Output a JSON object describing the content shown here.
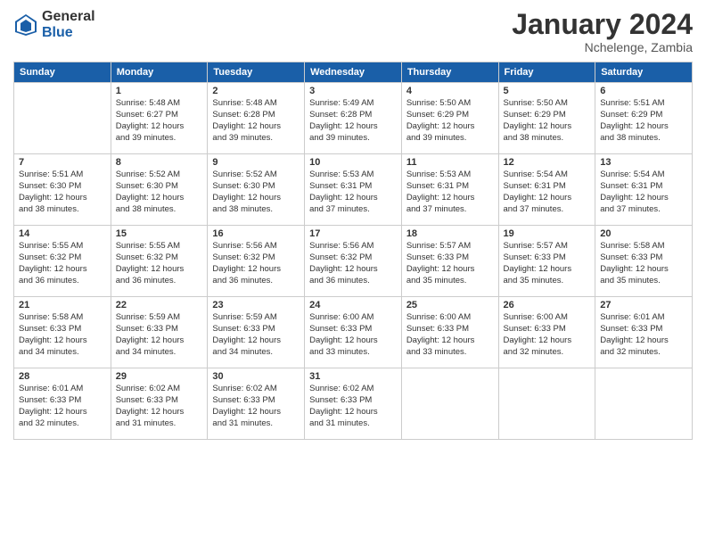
{
  "logo": {
    "general": "General",
    "blue": "Blue"
  },
  "header": {
    "title": "January 2024",
    "subtitle": "Nchelenge, Zambia"
  },
  "weekdays": [
    "Sunday",
    "Monday",
    "Tuesday",
    "Wednesday",
    "Thursday",
    "Friday",
    "Saturday"
  ],
  "weeks": [
    [
      {
        "day": "",
        "info": ""
      },
      {
        "day": "1",
        "info": "Sunrise: 5:48 AM\nSunset: 6:27 PM\nDaylight: 12 hours\nand 39 minutes."
      },
      {
        "day": "2",
        "info": "Sunrise: 5:48 AM\nSunset: 6:28 PM\nDaylight: 12 hours\nand 39 minutes."
      },
      {
        "day": "3",
        "info": "Sunrise: 5:49 AM\nSunset: 6:28 PM\nDaylight: 12 hours\nand 39 minutes."
      },
      {
        "day": "4",
        "info": "Sunrise: 5:50 AM\nSunset: 6:29 PM\nDaylight: 12 hours\nand 39 minutes."
      },
      {
        "day": "5",
        "info": "Sunrise: 5:50 AM\nSunset: 6:29 PM\nDaylight: 12 hours\nand 38 minutes."
      },
      {
        "day": "6",
        "info": "Sunrise: 5:51 AM\nSunset: 6:29 PM\nDaylight: 12 hours\nand 38 minutes."
      }
    ],
    [
      {
        "day": "7",
        "info": "Sunrise: 5:51 AM\nSunset: 6:30 PM\nDaylight: 12 hours\nand 38 minutes."
      },
      {
        "day": "8",
        "info": "Sunrise: 5:52 AM\nSunset: 6:30 PM\nDaylight: 12 hours\nand 38 minutes."
      },
      {
        "day": "9",
        "info": "Sunrise: 5:52 AM\nSunset: 6:30 PM\nDaylight: 12 hours\nand 38 minutes."
      },
      {
        "day": "10",
        "info": "Sunrise: 5:53 AM\nSunset: 6:31 PM\nDaylight: 12 hours\nand 37 minutes."
      },
      {
        "day": "11",
        "info": "Sunrise: 5:53 AM\nSunset: 6:31 PM\nDaylight: 12 hours\nand 37 minutes."
      },
      {
        "day": "12",
        "info": "Sunrise: 5:54 AM\nSunset: 6:31 PM\nDaylight: 12 hours\nand 37 minutes."
      },
      {
        "day": "13",
        "info": "Sunrise: 5:54 AM\nSunset: 6:31 PM\nDaylight: 12 hours\nand 37 minutes."
      }
    ],
    [
      {
        "day": "14",
        "info": "Sunrise: 5:55 AM\nSunset: 6:32 PM\nDaylight: 12 hours\nand 36 minutes."
      },
      {
        "day": "15",
        "info": "Sunrise: 5:55 AM\nSunset: 6:32 PM\nDaylight: 12 hours\nand 36 minutes."
      },
      {
        "day": "16",
        "info": "Sunrise: 5:56 AM\nSunset: 6:32 PM\nDaylight: 12 hours\nand 36 minutes."
      },
      {
        "day": "17",
        "info": "Sunrise: 5:56 AM\nSunset: 6:32 PM\nDaylight: 12 hours\nand 36 minutes."
      },
      {
        "day": "18",
        "info": "Sunrise: 5:57 AM\nSunset: 6:33 PM\nDaylight: 12 hours\nand 35 minutes."
      },
      {
        "day": "19",
        "info": "Sunrise: 5:57 AM\nSunset: 6:33 PM\nDaylight: 12 hours\nand 35 minutes."
      },
      {
        "day": "20",
        "info": "Sunrise: 5:58 AM\nSunset: 6:33 PM\nDaylight: 12 hours\nand 35 minutes."
      }
    ],
    [
      {
        "day": "21",
        "info": "Sunrise: 5:58 AM\nSunset: 6:33 PM\nDaylight: 12 hours\nand 34 minutes."
      },
      {
        "day": "22",
        "info": "Sunrise: 5:59 AM\nSunset: 6:33 PM\nDaylight: 12 hours\nand 34 minutes."
      },
      {
        "day": "23",
        "info": "Sunrise: 5:59 AM\nSunset: 6:33 PM\nDaylight: 12 hours\nand 34 minutes."
      },
      {
        "day": "24",
        "info": "Sunrise: 6:00 AM\nSunset: 6:33 PM\nDaylight: 12 hours\nand 33 minutes."
      },
      {
        "day": "25",
        "info": "Sunrise: 6:00 AM\nSunset: 6:33 PM\nDaylight: 12 hours\nand 33 minutes."
      },
      {
        "day": "26",
        "info": "Sunrise: 6:00 AM\nSunset: 6:33 PM\nDaylight: 12 hours\nand 32 minutes."
      },
      {
        "day": "27",
        "info": "Sunrise: 6:01 AM\nSunset: 6:33 PM\nDaylight: 12 hours\nand 32 minutes."
      }
    ],
    [
      {
        "day": "28",
        "info": "Sunrise: 6:01 AM\nSunset: 6:33 PM\nDaylight: 12 hours\nand 32 minutes."
      },
      {
        "day": "29",
        "info": "Sunrise: 6:02 AM\nSunset: 6:33 PM\nDaylight: 12 hours\nand 31 minutes."
      },
      {
        "day": "30",
        "info": "Sunrise: 6:02 AM\nSunset: 6:33 PM\nDaylight: 12 hours\nand 31 minutes."
      },
      {
        "day": "31",
        "info": "Sunrise: 6:02 AM\nSunset: 6:33 PM\nDaylight: 12 hours\nand 31 minutes."
      },
      {
        "day": "",
        "info": ""
      },
      {
        "day": "",
        "info": ""
      },
      {
        "day": "",
        "info": ""
      }
    ]
  ]
}
